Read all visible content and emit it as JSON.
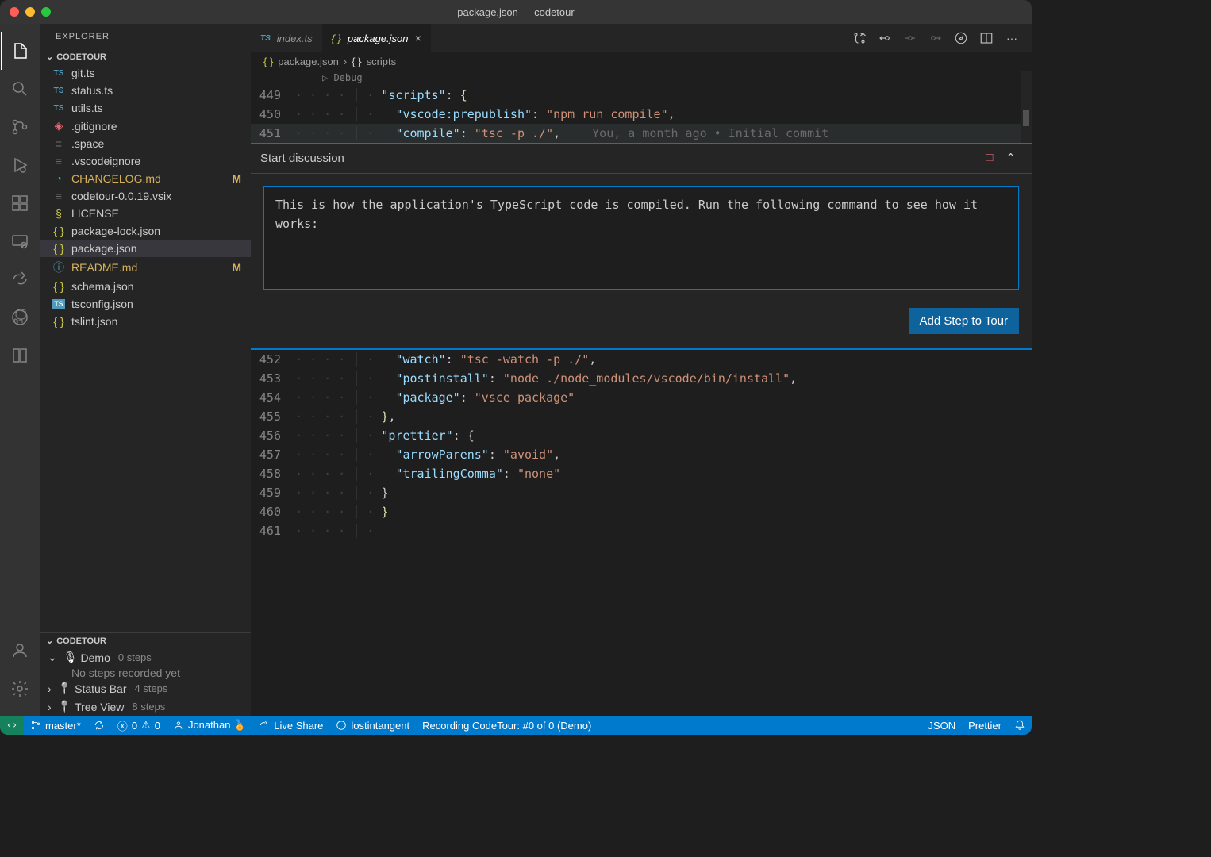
{
  "window": {
    "title": "package.json — codetour"
  },
  "sidebar": {
    "title": "EXPLORER",
    "section": "CODETOUR",
    "files": [
      {
        "icon": "ts",
        "name": "git.ts"
      },
      {
        "icon": "ts",
        "name": "status.ts"
      },
      {
        "icon": "ts",
        "name": "utils.ts"
      },
      {
        "icon": "git",
        "name": ".gitignore"
      },
      {
        "icon": "lines",
        "name": ".space"
      },
      {
        "icon": "lines",
        "name": ".vscodeignore"
      },
      {
        "icon": "clock",
        "name": "CHANGELOG.md",
        "modified": true
      },
      {
        "icon": "lines",
        "name": "codetour-0.0.19.vsix"
      },
      {
        "icon": "cert",
        "name": "LICENSE"
      },
      {
        "icon": "json",
        "name": "package-lock.json"
      },
      {
        "icon": "json",
        "name": "package.json",
        "selected": true
      },
      {
        "icon": "info",
        "name": "README.md",
        "modified": true
      },
      {
        "icon": "json",
        "name": "schema.json"
      },
      {
        "icon": "tsconf",
        "name": "tsconfig.json"
      },
      {
        "icon": "json",
        "name": "tslint.json"
      }
    ],
    "codetour_section": "CODETOUR",
    "tours": [
      {
        "name": "Demo",
        "steps": "0 steps",
        "expanded": true,
        "detail": "No steps recorded yet",
        "icon": "mic"
      },
      {
        "name": "Status Bar",
        "steps": "4 steps",
        "icon": "pin"
      },
      {
        "name": "Tree View",
        "steps": "8 steps",
        "icon": "pin"
      }
    ]
  },
  "tabs": [
    {
      "icon": "ts",
      "label": "index.ts",
      "active": false
    },
    {
      "icon": "json",
      "label": "package.json",
      "active": true
    }
  ],
  "breadcrumb": {
    "file": "package.json",
    "path": "scripts"
  },
  "code": {
    "debug_lens": "▷ Debug",
    "blame": "You, a month ago • Initial commit",
    "lines_top": [
      {
        "n": "449",
        "html": "<span class='tok-key'>\"scripts\"</span><span class='tok-punc'>: </span><span class='tok-brace'>{</span>"
      },
      {
        "n": "450",
        "html": "  <span class='tok-key'>\"vscode:prepublish\"</span><span class='tok-punc'>: </span><span class='tok-str'>\"npm run compile\"</span><span class='tok-punc'>,</span>"
      },
      {
        "n": "451",
        "html": "  <span class='tok-key'>\"compile\"</span><span class='tok-punc'>: </span><span class='tok-str'>\"tsc -p ./\"</span><span class='tok-punc'>,</span>",
        "highlight": true,
        "blame": true
      }
    ],
    "lines_bottom": [
      {
        "n": "452",
        "html": "  <span class='tok-key'>\"watch\"</span><span class='tok-punc'>: </span><span class='tok-str'>\"tsc -watch -p ./\"</span><span class='tok-punc'>,</span>"
      },
      {
        "n": "453",
        "html": "  <span class='tok-key'>\"postinstall\"</span><span class='tok-punc'>: </span><span class='tok-str'>\"node ./node_modules/vscode/bin/install\"</span><span class='tok-punc'>,</span>"
      },
      {
        "n": "454",
        "html": "  <span class='tok-key'>\"package\"</span><span class='tok-punc'>: </span><span class='tok-str'>\"vsce package\"</span>"
      },
      {
        "n": "455",
        "html": "<span class='tok-brace'>}</span><span class='tok-punc'>,</span>"
      },
      {
        "n": "456",
        "html": "<span class='tok-key'>\"prettier\"</span><span class='tok-punc'>: {</span>"
      },
      {
        "n": "457",
        "html": "  <span class='tok-key'>\"arrowParens\"</span><span class='tok-punc'>: </span><span class='tok-str'>\"avoid\"</span><span class='tok-punc'>,</span>"
      },
      {
        "n": "458",
        "html": "  <span class='tok-key'>\"trailingComma\"</span><span class='tok-punc'>: </span><span class='tok-str'>\"none\"</span>"
      },
      {
        "n": "459",
        "html": "<span class='tok-punc'>}</span>"
      },
      {
        "n": "460",
        "html": "<span class='tok-brace'>}</span>"
      },
      {
        "n": "461",
        "html": ""
      }
    ]
  },
  "widget": {
    "title": "Start discussion",
    "text": "This is how the application's TypeScript code is compiled. Run the following command to see how it works:",
    "button": "Add Step to Tour"
  },
  "status": {
    "branch": "master*",
    "errors": "0",
    "warnings": "0",
    "user": "Jonathan 🏅",
    "liveshare": "Live Share",
    "account": "lostintangent",
    "recording": "Recording CodeTour: #0 of 0 (Demo)",
    "lang": "JSON",
    "formatter": "Prettier"
  }
}
